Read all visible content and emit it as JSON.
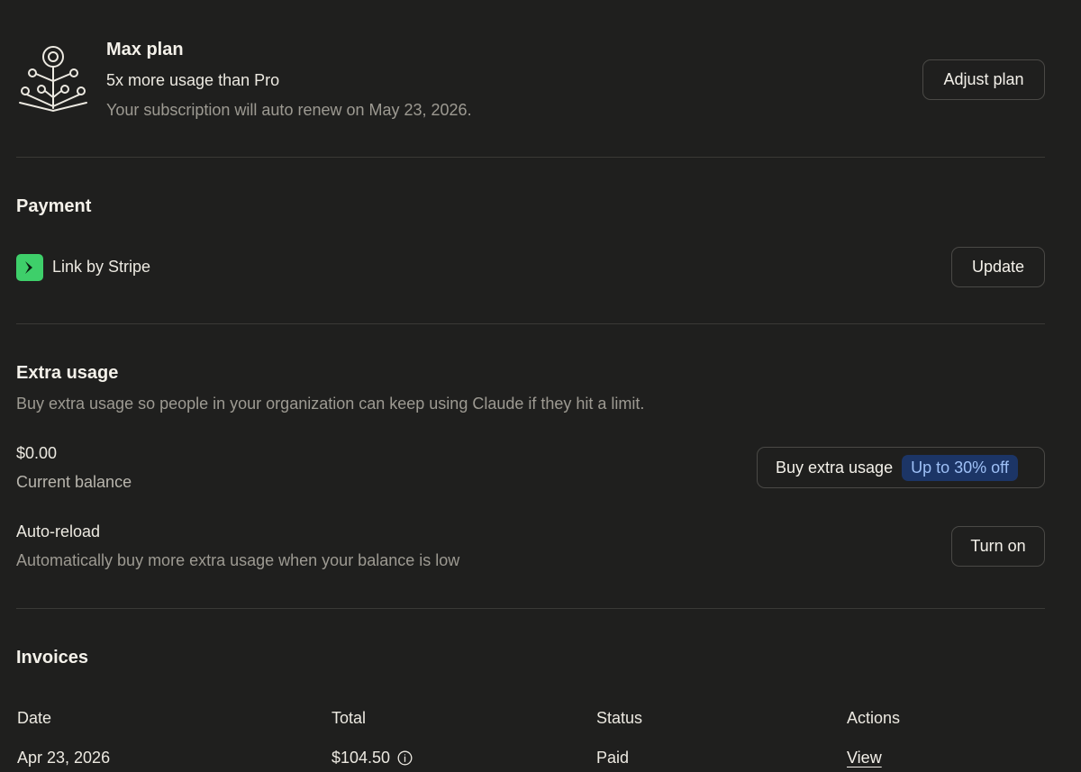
{
  "plan": {
    "title": "Max plan",
    "subtitle": "5x more usage than Pro",
    "renewal_text": "Your subscription will auto renew on May 23, 2026.",
    "adjust_label": "Adjust plan",
    "icon": "plan-tree-icon"
  },
  "payment": {
    "heading": "Payment",
    "method_label": "Link by Stripe",
    "method_icon": "stripe-link-icon",
    "method_color": "#3ecf6a",
    "update_label": "Update"
  },
  "extra_usage": {
    "heading": "Extra usage",
    "description": "Buy extra usage so people in your organization can keep using Claude if they hit a limit.",
    "balance_value": "$0.00",
    "balance_label": "Current balance",
    "buy_label": "Buy extra usage",
    "discount_badge": "Up to 30% off",
    "badge_color": "#1c3566",
    "auto_reload": {
      "label": "Auto-reload",
      "description": "Automatically buy more extra usage when your balance is low",
      "button_label": "Turn on"
    }
  },
  "invoices": {
    "heading": "Invoices",
    "columns": [
      "Date",
      "Total",
      "Status",
      "Actions"
    ],
    "rows": [
      {
        "date": "Apr 23, 2026",
        "total": "$104.50",
        "status": "Paid",
        "action": "View"
      }
    ]
  }
}
